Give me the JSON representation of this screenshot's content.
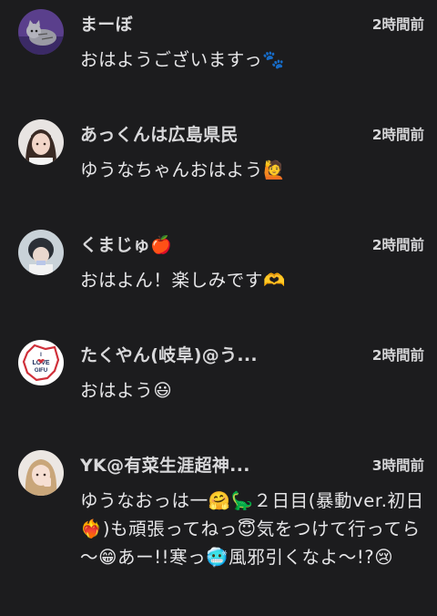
{
  "comments": [
    {
      "username": "まーぼ",
      "time": "2時間前",
      "text": "おはようございますっ🐾"
    },
    {
      "username": "あっくんは広島県民",
      "time": "2時間前",
      "text": "ゆうなちゃんおはよう🙋"
    },
    {
      "username": "くまじゅ🍎",
      "time": "2時間前",
      "text": "おはよん！楽しみです🫶"
    },
    {
      "username": "たくやん(岐阜)@う...",
      "time": "2時間前",
      "text": "おはよう😃",
      "avatar_text": [
        "I",
        "LOVE",
        "GIFU"
      ]
    },
    {
      "username": "YK@有菜生涯超神...",
      "time": "3時間前",
      "text": "ゆうなおっは一🤗🦕２日目(暴動ver.初日❤️‍🔥)も頑張ってねっ😇気をつけて行ってら～😁あー!!寒っ🥶風邪引くなよ～!?😢"
    }
  ],
  "colors": {
    "background": "#1c1c1e",
    "text": "#e6e6e8",
    "username": "#d8d8da"
  }
}
